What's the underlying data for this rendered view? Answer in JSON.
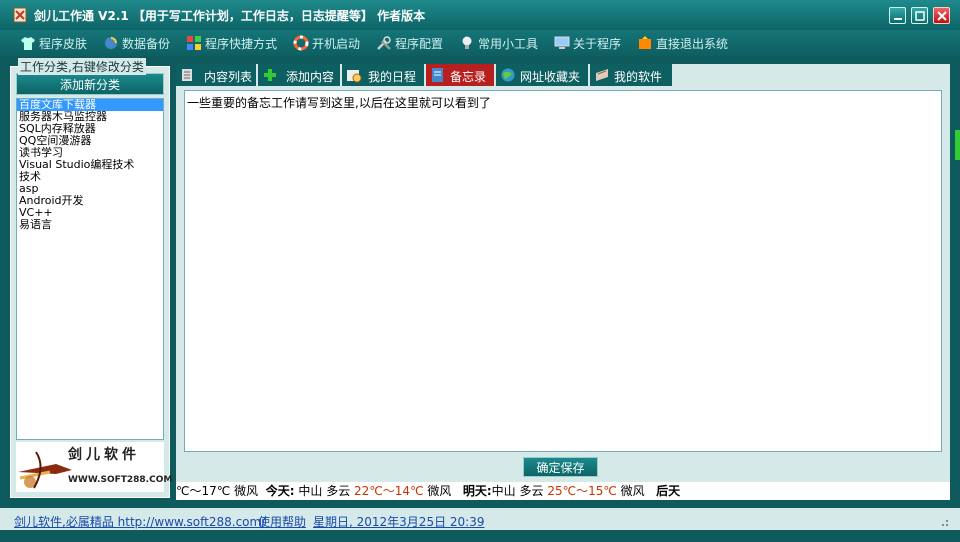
{
  "window": {
    "title": "剑儿工作通 V2.1 【用于写工作计划，工作日志，日志提醒等】 作者版本",
    "colors": {
      "accent": "#0f5a5c",
      "active_tab": "#b7201f",
      "panel": "#d6e9e9"
    }
  },
  "menu": [
    {
      "label": "程序皮肤",
      "icon": "shirt-icon"
    },
    {
      "label": "数据备份",
      "icon": "backup-icon"
    },
    {
      "label": "程序快捷方式",
      "icon": "shortcut-icon"
    },
    {
      "label": "开机启动",
      "icon": "lifebuoy-icon"
    },
    {
      "label": "程序配置",
      "icon": "tools-icon"
    },
    {
      "label": "常用小工具",
      "icon": "bulb-icon"
    },
    {
      "label": "关于程序",
      "icon": "monitor-icon"
    },
    {
      "label": "直接退出系统",
      "icon": "exit-icon"
    }
  ],
  "left": {
    "group_caption": "工作分类,右键修改分类",
    "add_button": "添加新分类",
    "categories": [
      "百度文库下载器",
      "服务器木马监控器",
      "SQL内存释放器",
      "QQ空间漫游器",
      "读书学习",
      "Visual Studio编程技术",
      "技术",
      "asp",
      "Android开发",
      "VC++",
      "易语言"
    ],
    "selected_index": 0,
    "logo": {
      "title": "剑儿软件",
      "url": "WWW.SOFT288.COM"
    }
  },
  "tabs": [
    {
      "label": "内容列表",
      "icon": "list-icon"
    },
    {
      "label": "添加内容",
      "icon": "plus-icon"
    },
    {
      "label": "我的日程",
      "icon": "calendar-icon"
    },
    {
      "label": "备忘录",
      "icon": "memo-icon",
      "active": true
    },
    {
      "label": "网址收藏夹",
      "icon": "globe-icon"
    },
    {
      "label": "我的软件",
      "icon": "software-icon"
    }
  ],
  "memo": {
    "text": "一些重要的备忘工作请写到这里,以后在这里就可以看到了",
    "save_button": "确定保存"
  },
  "weather": {
    "part1": "℃～17℃",
    "part2": "微风",
    "today_label": "今天:",
    "today_city": "中山",
    "today_cond": "多云",
    "today_temp": "22℃～14℃",
    "today_wind": "微风",
    "tomorrow_label": "明天:",
    "tomorrow_city": "中山",
    "tomorrow_cond": "多云",
    "tomorrow_temp": "25℃～15℃",
    "tomorrow_wind": "微风",
    "after_label": "后天"
  },
  "status": {
    "site": "剑儿软件,必属精品 http://www.soft288.com/",
    "help": "使用帮助",
    "datetime": "星期日, 2012年3月25日 20:39"
  }
}
